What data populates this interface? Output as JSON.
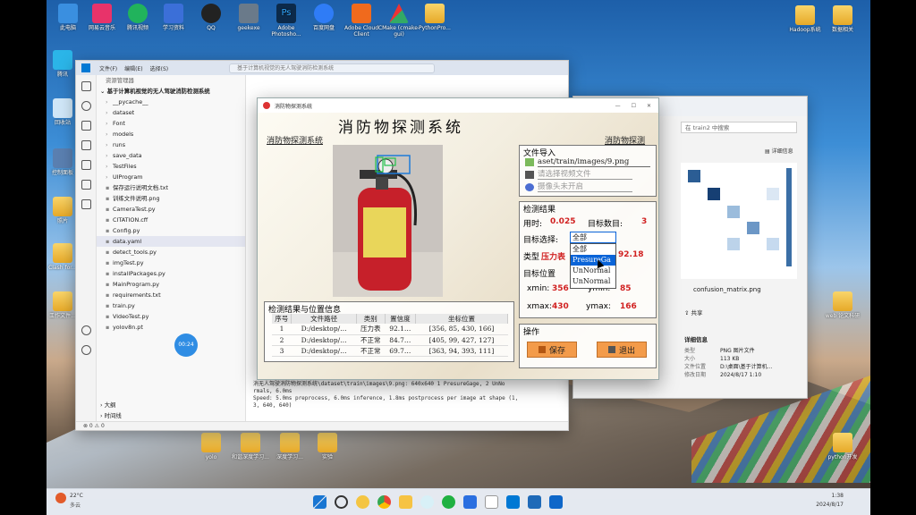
{
  "desktop": {
    "icons_left": [
      {
        "label": "此电脑"
      },
      {
        "label": "网易云音乐"
      },
      {
        "label": "腾讯视频"
      },
      {
        "label": "学习资料"
      },
      {
        "label": "QQ"
      },
      {
        "label": "geekexe"
      },
      {
        "label": "Adobe Photosho..."
      },
      {
        "label": "百度网盘"
      },
      {
        "label": "Adobe Cloud Client"
      },
      {
        "label": "CMake (cmake-gui)"
      },
      {
        "label": "PythonPro..."
      }
    ],
    "icons_right": [
      {
        "label": "Hadoop系统"
      },
      {
        "label": "数据相关"
      }
    ],
    "icons_col_left": [
      {
        "label": "腾讯"
      },
      {
        "label": "回收站"
      },
      {
        "label": "控制面板"
      },
      {
        "label": "照片"
      },
      {
        "label": "Clash for..."
      },
      {
        "label": "工作文件..."
      }
    ],
    "icons_col_right": [
      {
        "label": "web 论文科研"
      },
      {
        "label": "python开发"
      }
    ],
    "bottom_icons": [
      {
        "label": "yolo"
      },
      {
        "label": "和谐深度学习..."
      },
      {
        "label": "深度学习..."
      },
      {
        "label": "实验"
      }
    ]
  },
  "taskbar": {
    "weather_temp": "22°C",
    "weather_desc": "多云",
    "time": "1:38",
    "date": "2024/8/17"
  },
  "vscode": {
    "menu": [
      "文件(F)",
      "编辑(E)",
      "选择(S)"
    ],
    "search_placeholder": "基于计算机视觉的无人驾驶消防检测系统",
    "explorer_title": "资源管理器",
    "project_root": "基于计算机视觉的无人驾驶消防检测系统",
    "files": [
      "__pycache__",
      "dataset",
      "Font",
      "models",
      "runs",
      "save_data",
      "TestFiles",
      "UIProgram",
      "保存运行说明文档.txt",
      "训练文件说明.png",
      "CameraTest.py",
      "CITATION.cff",
      "Config.py",
      "data.yaml",
      "detect_tools.py",
      "imgTest.py",
      "installPackages.py",
      "MainProgram.py",
      "requirements.txt",
      "train.py",
      "VideoTest.py",
      "yolov8n.pt"
    ],
    "outline": "大纲",
    "timeline": "时间线",
    "timer": "00:24",
    "terminal_lines": [
      "消无人驾驶消防物探测系统\\dataset\\train\\images\\9.png: 640x640 1 PresureGage, 2 UnNo",
      "rmals, 6.0ms",
      "Speed: 5.0ms preprocess, 6.0ms inference, 1.8ms postprocess per image at shape (1,",
      " 3, 640, 640)"
    ],
    "status": "⊗ 0 ⚠ 0"
  },
  "file_explorer": {
    "search_placeholder": "在 train2 中搜索",
    "details_btn": "详细信息",
    "file_name": "confusion_matrix.png",
    "share": "共享",
    "details_title": "详细信息",
    "details": [
      {
        "k": "类型",
        "v": "PNG 图片文件"
      },
      {
        "k": "大小",
        "v": "113 KB"
      },
      {
        "k": "文件位置",
        "v": "D:\\桌面\\基于计算机..."
      },
      {
        "k": "修改日期",
        "v": "2024/8/17 1:10"
      }
    ]
  },
  "app": {
    "window_title": "消防物探测系统",
    "title": "消防物探测系统",
    "subtitle_left": "消防物探测系统",
    "subtitle_right": "消防物探测",
    "file_import_title": "文件导入",
    "image_path": "aset/train/images/9.png",
    "video_placeholder": "请选择视频文件",
    "camera_status": "摄像头未开启",
    "results_title": "检测结果",
    "time_label": "用时:",
    "time_value": "0.025",
    "count_label": "目标数目:",
    "count_value": "3",
    "target_select_label": "目标选择:",
    "target_selected": "全部",
    "type_label": "类型",
    "type_value": "压力表",
    "confidence_value": "92.18",
    "position_label": "目标位置",
    "xmin_label": "xmin:",
    "xmin_value": "356",
    "ymin_label": "ymin:",
    "ymin_value": "85",
    "xmax_label": "xmax:",
    "xmax_value": "430",
    "ymax_label": "ymax:",
    "ymax_value": "166",
    "dropdown_options": [
      "全部",
      "PresureGa",
      "UnNormal",
      "UnNormal"
    ],
    "dropdown_highlight_index": 1,
    "ops_title": "操作",
    "save_label": "保存",
    "exit_label": "退出",
    "table_title": "检测结果与位置信息",
    "table_headers": [
      "序号",
      "文件路径",
      "类别",
      "置信度",
      "坐标位置"
    ],
    "table_rows": [
      [
        "1",
        "D:/desktop/…",
        "压力表",
        "92.1…",
        "[356, 85, 430, 166]"
      ],
      [
        "2",
        "D:/desktop/…",
        "不正常",
        "84.7…",
        "[405, 99, 427, 127]"
      ],
      [
        "3",
        "D:/desktop/…",
        "不正常",
        "69.7…",
        "[363, 94, 393, 111]"
      ]
    ],
    "detection_label": "0"
  },
  "colors": {
    "accent_red": "#d12222",
    "select_blue": "#0a64d8",
    "button_orange": "#f39b4a"
  }
}
